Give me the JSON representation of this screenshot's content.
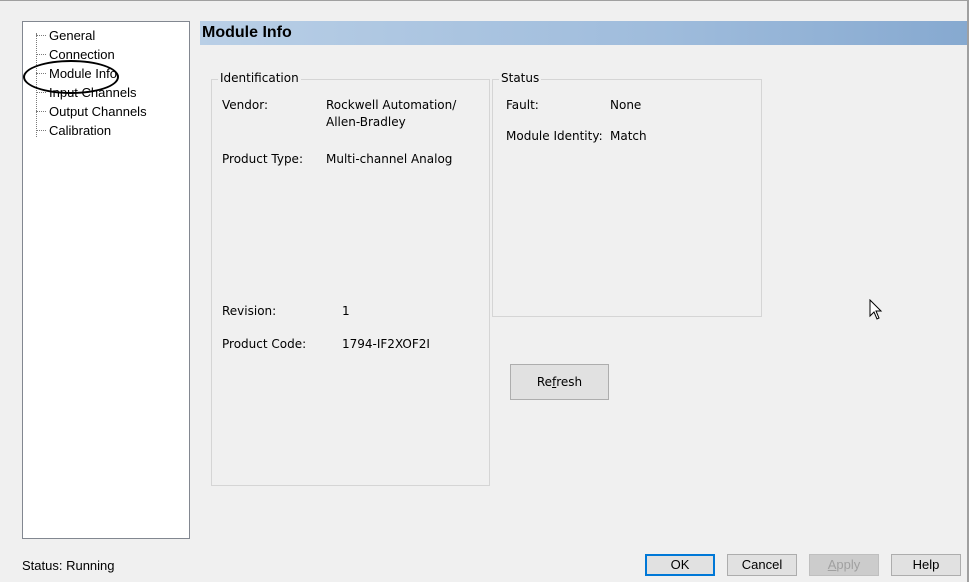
{
  "tree": {
    "items": [
      {
        "label": "General"
      },
      {
        "label": "Connection"
      },
      {
        "label": "Module Info"
      },
      {
        "label": "Input Channels"
      },
      {
        "label": "Output Channels"
      },
      {
        "label": "Calibration"
      }
    ],
    "selected": "Module Info"
  },
  "header": {
    "title": "Module Info"
  },
  "identification": {
    "title": "Identification",
    "vendor_label": "Vendor:",
    "vendor_value": "Rockwell Automation/ Allen-Bradley",
    "product_type_label": "Product Type:",
    "product_type_value": "Multi-channel Analog",
    "revision_label": "Revision:",
    "revision_value": "1",
    "product_code_label": "Product Code:",
    "product_code_value": "1794-IF2XOF2I"
  },
  "status": {
    "title": "Status",
    "fault_label": "Fault:",
    "fault_value": "None",
    "identity_label": "Module Identity:",
    "identity_value": "Match"
  },
  "buttons": {
    "refresh_pre": "Re",
    "refresh_mnemonic": "f",
    "refresh_post": "resh",
    "ok": "OK",
    "cancel": "Cancel",
    "apply_mnemonic": "A",
    "apply_rest": "pply",
    "help": "Help"
  },
  "footer": {
    "status": "Status:  Running"
  },
  "colors": {
    "accent": "#0078d7",
    "header_gradient_start": "#b9cfe6",
    "header_gradient_end": "#86a9d0"
  }
}
